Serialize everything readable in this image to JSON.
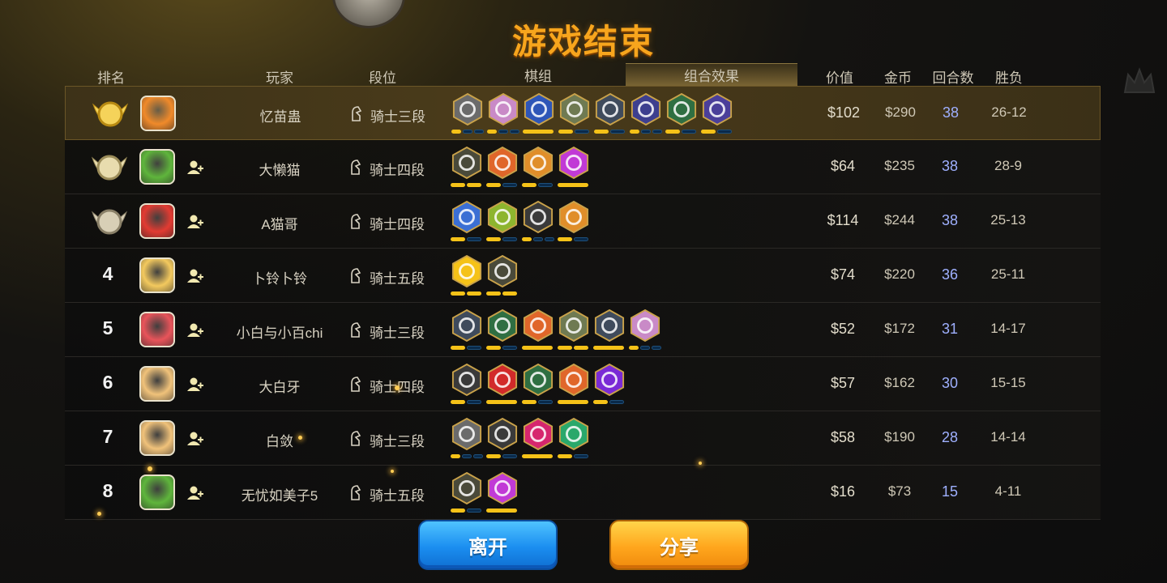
{
  "title": "游戏结束",
  "headers": {
    "rank": "排名",
    "player": "玩家",
    "tier": "段位",
    "pieces": "棋组",
    "combo": "组合效果",
    "value": "价值",
    "gold": "金币",
    "rounds": "回合数",
    "win_loss": "胜负"
  },
  "colors": {
    "title": "#f7a51d",
    "pip_on": "#f5c218",
    "pip_off": "#0a2a4a",
    "rounds_text": "#9fb0ff",
    "leave_button": "#1b8ef0",
    "share_button": "#ffa61d"
  },
  "rows": [
    {
      "rank": "",
      "medal": "gold-medal-icon",
      "avatar_color": "#f08a2a",
      "name": "忆苗蛊",
      "tier": "骑士三段",
      "value": "$102",
      "gold": "$290",
      "rounds": "38",
      "win_loss": "26-12",
      "traits": [
        {
          "icon": "hat-icon",
          "color": "#6b6b6b",
          "pips": [
            1,
            0,
            0
          ]
        },
        {
          "icon": "knight-icon",
          "color": "#c98ac7",
          "pips": [
            1,
            0,
            0
          ]
        },
        {
          "icon": "shatter-icon",
          "color": "#2e56b8",
          "pips": [
            1
          ]
        },
        {
          "icon": "beetle-icon",
          "color": "#6f7a52",
          "pips": [
            1,
            0
          ]
        },
        {
          "icon": "paw-group-icon",
          "color": "#3f4b5c",
          "pips": [
            1,
            0
          ]
        },
        {
          "icon": "book-icon",
          "color": "#3d3f8f",
          "pips": [
            1,
            0,
            0
          ]
        },
        {
          "icon": "crossbow-icon",
          "color": "#2f6f42",
          "pips": [
            1,
            0
          ]
        },
        {
          "icon": "fishbone-icon",
          "color": "#4b3f9a",
          "pips": [
            1,
            0
          ]
        }
      ]
    },
    {
      "rank": "",
      "medal": "silver-medal-icon",
      "avatar_color": "#5fb53c",
      "name": "大懒猫",
      "tier": "骑士四段",
      "value": "$64",
      "gold": "$235",
      "rounds": "38",
      "win_loss": "28-9",
      "traits": [
        {
          "icon": "claws-icon",
          "color": "#4a4a3a",
          "pips": [
            1,
            1
          ]
        },
        {
          "icon": "demon-face-icon",
          "color": "#e0662a",
          "pips": [
            1,
            0
          ]
        },
        {
          "icon": "gear-icon",
          "color": "#e08e2a",
          "pips": [
            1,
            0
          ]
        },
        {
          "icon": "imp-icon",
          "color": "#c13ad6",
          "pips": [
            1
          ]
        }
      ]
    },
    {
      "rank": "",
      "medal": "bronze-medal-icon",
      "avatar_color": "#e23b32",
      "name": "A猫哥",
      "tier": "骑士四段",
      "value": "$114",
      "gold": "$244",
      "rounds": "38",
      "win_loss": "25-13",
      "traits": [
        {
          "icon": "feather-icon",
          "color": "#3b6fd4",
          "pips": [
            1,
            0
          ]
        },
        {
          "icon": "cluster-icon",
          "color": "#8db52e",
          "pips": [
            1,
            0
          ]
        },
        {
          "icon": "axe-icon",
          "color": "#3a3a3a",
          "pips": [
            1,
            0,
            0
          ]
        },
        {
          "icon": "leaf-icon",
          "color": "#e08e2a",
          "pips": [
            1,
            0
          ]
        }
      ]
    },
    {
      "rank": "4",
      "medal": "",
      "avatar_color": "#f3c95e",
      "name": "卜铃卜铃",
      "tier": "骑士五段",
      "value": "$74",
      "gold": "$220",
      "rounds": "36",
      "win_loss": "25-11",
      "traits": [
        {
          "icon": "eye-icon",
          "color": "#f5c218",
          "pips": [
            1,
            1
          ]
        },
        {
          "icon": "claws-icon",
          "color": "#4a4a3a",
          "pips": [
            1,
            1
          ]
        }
      ]
    },
    {
      "rank": "5",
      "medal": "",
      "avatar_color": "#e8545a",
      "name": "小白与小百chi",
      "tier": "骑士三段",
      "value": "$52",
      "gold": "$172",
      "rounds": "31",
      "win_loss": "14-17",
      "traits": [
        {
          "icon": "paw-group-icon",
          "color": "#3f4b5c",
          "pips": [
            1,
            0
          ]
        },
        {
          "icon": "crossbow-icon",
          "color": "#2f6f42",
          "pips": [
            1,
            0
          ]
        },
        {
          "icon": "ogre-icon",
          "color": "#e0662a",
          "pips": [
            1
          ]
        },
        {
          "icon": "beetle-icon",
          "color": "#6f7a52",
          "pips": [
            1,
            1
          ]
        },
        {
          "icon": "cross-icon",
          "color": "#3f4b5c",
          "pips": [
            1
          ]
        },
        {
          "icon": "knight-icon",
          "color": "#c98ac7",
          "pips": [
            1,
            0,
            0
          ]
        }
      ]
    },
    {
      "rank": "6",
      "medal": "",
      "avatar_color": "#f0c27a",
      "name": "大白牙",
      "tier": "骑士四段",
      "value": "$57",
      "gold": "$162",
      "rounds": "30",
      "win_loss": "15-15",
      "traits": [
        {
          "icon": "axe-icon",
          "color": "#3a3a3a",
          "pips": [
            1,
            0
          ]
        },
        {
          "icon": "arch-icon",
          "color": "#d22a2a",
          "pips": [
            1
          ]
        },
        {
          "icon": "crossbow-icon",
          "color": "#2f6f42",
          "pips": [
            1,
            0
          ]
        },
        {
          "icon": "ogre-icon",
          "color": "#e0662a",
          "pips": [
            1
          ]
        },
        {
          "icon": "wing-icon",
          "color": "#7a2ad6",
          "pips": [
            1,
            0
          ]
        }
      ]
    },
    {
      "rank": "7",
      "medal": "",
      "avatar_color": "#f0c27a",
      "name": "白敛",
      "tier": "骑士三段",
      "value": "$58",
      "gold": "$190",
      "rounds": "28",
      "win_loss": "14-14",
      "traits": [
        {
          "icon": "hat-icon",
          "color": "#6b6b6b",
          "pips": [
            1,
            0,
            0
          ]
        },
        {
          "icon": "axe-icon",
          "color": "#3a3a3a",
          "pips": [
            1,
            0
          ]
        },
        {
          "icon": "flame-icon",
          "color": "#d6266e",
          "pips": [
            1
          ]
        },
        {
          "icon": "paw-icon",
          "color": "#2aa86b",
          "pips": [
            1,
            0
          ]
        }
      ]
    },
    {
      "rank": "8",
      "medal": "",
      "avatar_color": "#5fb53c",
      "name": "无忧如美子5",
      "tier": "骑士五段",
      "value": "$16",
      "gold": "$73",
      "rounds": "15",
      "win_loss": "4-11",
      "traits": [
        {
          "icon": "claws-icon",
          "color": "#4a4a3a",
          "pips": [
            1,
            0
          ]
        },
        {
          "icon": "imp-icon",
          "color": "#c13ad6",
          "pips": [
            1
          ]
        }
      ]
    }
  ],
  "buttons": {
    "leave": "离开",
    "share": "分享"
  }
}
